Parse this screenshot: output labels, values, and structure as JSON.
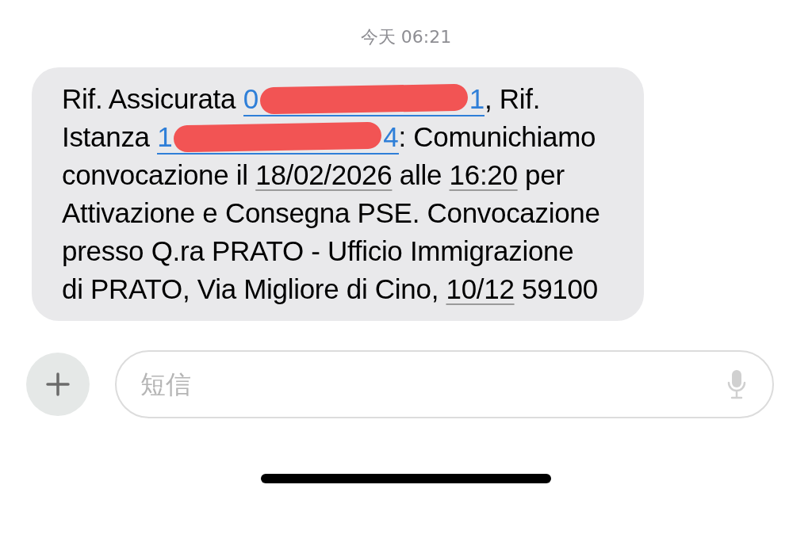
{
  "timestamp": "今天 06:21",
  "message": {
    "segments": [
      {
        "kind": "text",
        "text": "Rif. Assicurata "
      },
      {
        "kind": "redacted_link",
        "start": "0",
        "end": "1"
      },
      {
        "kind": "text",
        "text": ", Rif. Istanza "
      },
      {
        "kind": "redacted_link",
        "start": "1",
        "end": "4"
      },
      {
        "kind": "text",
        "text": ": Comunichiamo convocazione il "
      },
      {
        "kind": "detected",
        "text": "18/02/2026"
      },
      {
        "kind": "text",
        "text": " alle "
      },
      {
        "kind": "detected",
        "text": "16:20"
      },
      {
        "kind": "text",
        "text": " per Attivazione e Consegna PSE. Convocazione presso Q.ra PRATO - Ufficio Immigrazione di PRATO, Via Migliore di Cino, "
      },
      {
        "kind": "detected",
        "text": "10/12"
      },
      {
        "kind": "text",
        "text": " 59100"
      }
    ]
  },
  "composer": {
    "placeholder": "短信"
  }
}
